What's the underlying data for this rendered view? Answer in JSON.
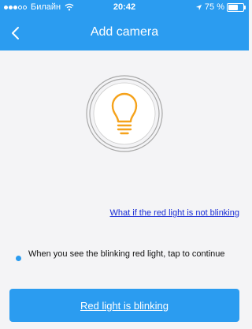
{
  "status_bar": {
    "carrier": "Билайн",
    "time": "20:42",
    "battery_percent": "75 %",
    "battery_level": 0.75,
    "signal_bars_filled": 3,
    "signal_bars_total": 5
  },
  "nav": {
    "title": "Add camera",
    "back_icon": "chevron-left-icon"
  },
  "illustration": {
    "icon": "lightbulb-icon",
    "accent_color": "#f5a21b"
  },
  "help_link": {
    "label": "What if the red light is not blinking"
  },
  "instruction": {
    "text": "When you see the blinking red light, tap to continue"
  },
  "primary_button": {
    "label": "Red light is blinking"
  },
  "colors": {
    "brand": "#2b9cf0",
    "link": "#1a2dd6",
    "background": "#f4f4f6"
  }
}
